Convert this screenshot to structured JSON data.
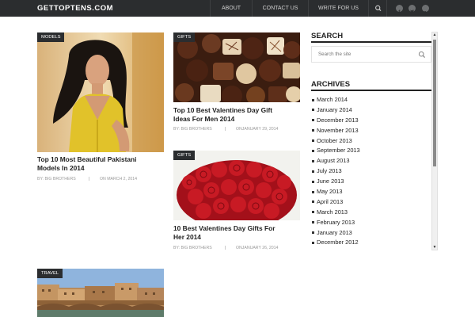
{
  "site": {
    "logo": "GETTOPTENS.COM"
  },
  "nav": {
    "items": [
      "ABOUT",
      "CONTACT US",
      "WRITE FOR US"
    ],
    "search_icon": "search-icon",
    "social": [
      "facebook-icon",
      "twitter-icon",
      "google-plus-icon"
    ]
  },
  "posts": [
    {
      "category": "MODELS",
      "title_lines": [
        "Top 10 Most Beautiful Pakistani",
        "Models In 2014"
      ],
      "author": "BY: BIG BROTHERS",
      "date": "ON MARCH 2, 2014"
    },
    {
      "category": "GIFTS",
      "title_lines": [
        "Top 10 Best Valentines Day Gift",
        "Ideas For Men 2014"
      ],
      "author": "BY: BIG BROTHERS",
      "date": "ONJANUARY 29, 2014"
    },
    {
      "category": "GIFTS",
      "title_lines": [
        "10 Best Valentines Day Gifts For",
        "Her 2014"
      ],
      "author": "BY: BIG BROTHERS",
      "date": "ONJANUARY 26, 2014"
    },
    {
      "category": "TRAVEL"
    }
  ],
  "sidebar": {
    "search_title": "SEARCH",
    "search_placeholder": "Search the site",
    "archives_title": "ARCHIVES",
    "archives": [
      "March 2014",
      "January 2014",
      "December 2013",
      "November 2013",
      "October 2013",
      "September 2013",
      "August 2013",
      "July 2013",
      "June 2013",
      "May 2013",
      "April 2013",
      "March 2013",
      "February 2013",
      "January 2013",
      "December 2012"
    ]
  },
  "colors": {
    "topbar": "#2b2d2f",
    "accent": "#222222",
    "meta": "#999999"
  }
}
